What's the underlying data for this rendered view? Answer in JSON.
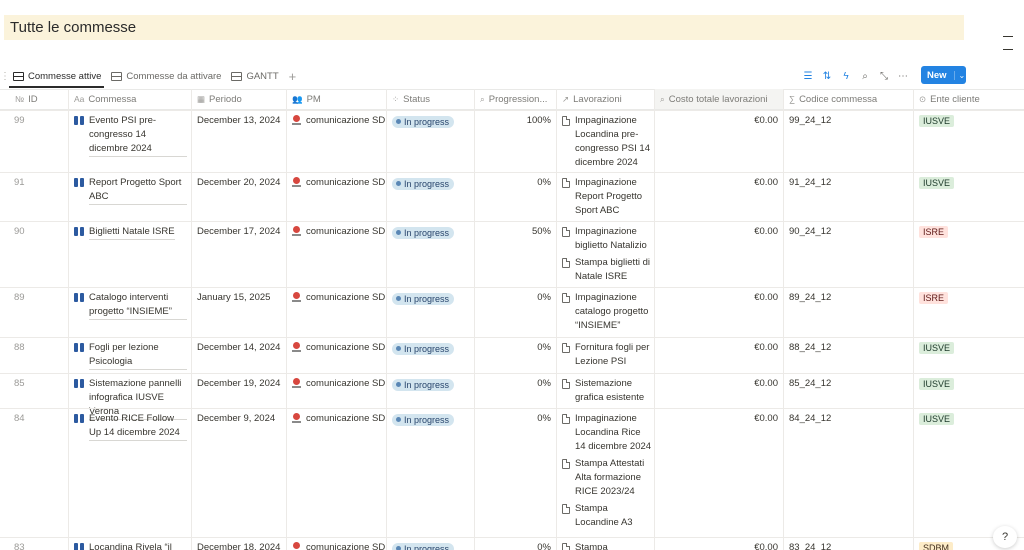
{
  "page": {
    "title": "Tutte le commesse"
  },
  "tabs": [
    {
      "label": "Commesse attive",
      "icon": "table-icon",
      "active": true
    },
    {
      "label": "Commesse da attivare",
      "icon": "table-icon",
      "active": false
    },
    {
      "label": "GANTT",
      "icon": "timeline-icon",
      "active": false
    }
  ],
  "toolbar": {
    "icons": [
      "filter-icon",
      "sort-icon",
      "automation-icon",
      "search-icon",
      "expand-icon",
      "more-icon"
    ],
    "new_label": "New",
    "accent": "#2383e2"
  },
  "columns": [
    {
      "label": "ID",
      "icon": "number-icon"
    },
    {
      "label": "Commessa",
      "icon": "title-icon"
    },
    {
      "label": "Periodo",
      "icon": "calendar-icon"
    },
    {
      "label": "PM",
      "icon": "people-icon"
    },
    {
      "label": "Status",
      "icon": "status-icon"
    },
    {
      "label": "Progression...",
      "icon": "search-icon"
    },
    {
      "label": "Lavorazioni",
      "icon": "relation-icon"
    },
    {
      "label": "Costo totale lavorazioni",
      "icon": "search-icon"
    },
    {
      "label": "Codice commessa",
      "icon": "formula-icon"
    },
    {
      "label": "Ente cliente",
      "icon": "select-icon"
    }
  ],
  "tag_colors": {
    "IUSVE": {
      "bg": "#dbeddb",
      "fg": "#1c3829"
    },
    "ISRE": {
      "bg": "#ffe2dd",
      "fg": "#5d1715"
    },
    "SDBM": {
      "bg": "#fdecc8",
      "fg": "#402c1b"
    }
  },
  "rows": [
    {
      "id": "99",
      "commessa": "Evento PSI pre-congresso 14 dicembre 2024",
      "periodo": "December 13, 2024",
      "pm": "comunicazione SDE",
      "status": "In progress",
      "progress": "100%",
      "lavorazioni": [
        "Impaginazione Locandina pre-congresso PSI 14 dicembre 2024"
      ],
      "costo": "€0.00",
      "codice": "99_24_12",
      "ente": "IUSVE"
    },
    {
      "id": "91",
      "commessa": "Report Progetto Sport ABC",
      "periodo": "December 20, 2024",
      "pm": "comunicazione SDE",
      "status": "In progress",
      "progress": "0%",
      "lavorazioni": [
        "Impaginazione Report Progetto Sport ABC"
      ],
      "costo": "€0.00",
      "codice": "91_24_12",
      "ente": "IUSVE"
    },
    {
      "id": "90",
      "commessa": "Biglietti Natale ISRE",
      "periodo": "December 17, 2024",
      "pm": "comunicazione SDE",
      "status": "In progress",
      "progress": "50%",
      "lavorazioni": [
        "Impaginazione biglietto Natalizio",
        "Stampa biglietti di Natale ISRE"
      ],
      "costo": "€0.00",
      "codice": "90_24_12",
      "ente": "ISRE"
    },
    {
      "id": "89",
      "commessa": "Catalogo interventi progetto “INSIEME”",
      "periodo": "January 15, 2025",
      "pm": "comunicazione SDE",
      "status": "In progress",
      "progress": "0%",
      "lavorazioni": [
        "Impaginazione catalogo progetto “INSIEME”"
      ],
      "costo": "€0.00",
      "codice": "89_24_12",
      "ente": "ISRE"
    },
    {
      "id": "88",
      "commessa": "Fogli per lezione Psicologia",
      "periodo": "December 14, 2024",
      "pm": "comunicazione SDE",
      "status": "In progress",
      "progress": "0%",
      "lavorazioni": [
        "Fornitura fogli per Lezione PSI"
      ],
      "costo": "€0.00",
      "codice": "88_24_12",
      "ente": "IUSVE"
    },
    {
      "id": "85",
      "commessa": "Sistemazione pannelli infografica IUSVE Verona",
      "periodo": "December 19, 2024",
      "pm": "comunicazione SDE",
      "status": "In progress",
      "progress": "0%",
      "lavorazioni": [
        "Sistemazione grafica esistente"
      ],
      "costo": "€0.00",
      "codice": "85_24_12",
      "ente": "IUSVE"
    },
    {
      "id": "84",
      "commessa": "Evento RICE Follow Up 14 dicembre 2024",
      "periodo": "December 9, 2024",
      "pm": "comunicazione SDE",
      "status": "In progress",
      "progress": "0%",
      "lavorazioni": [
        "Impaginazione Locandina Rice 14 dicembre 2024",
        "Stampa Attestati Alta formazione RICE 2023/24",
        "Stampa Locandine A3"
      ],
      "costo": "€0.00",
      "codice": "84_24_12",
      "ente": "IUSVE"
    },
    {
      "id": "83",
      "commessa": "Locandina Rivela “il",
      "periodo": "December 18, 2024",
      "pm": "comunicazione SDE",
      "status": "In progress",
      "progress": "0%",
      "lavorazioni": [
        "Stampa"
      ],
      "costo": "€0.00",
      "codice": "83_24_12",
      "ente": "SDBM"
    }
  ],
  "help": {
    "label": "?"
  }
}
